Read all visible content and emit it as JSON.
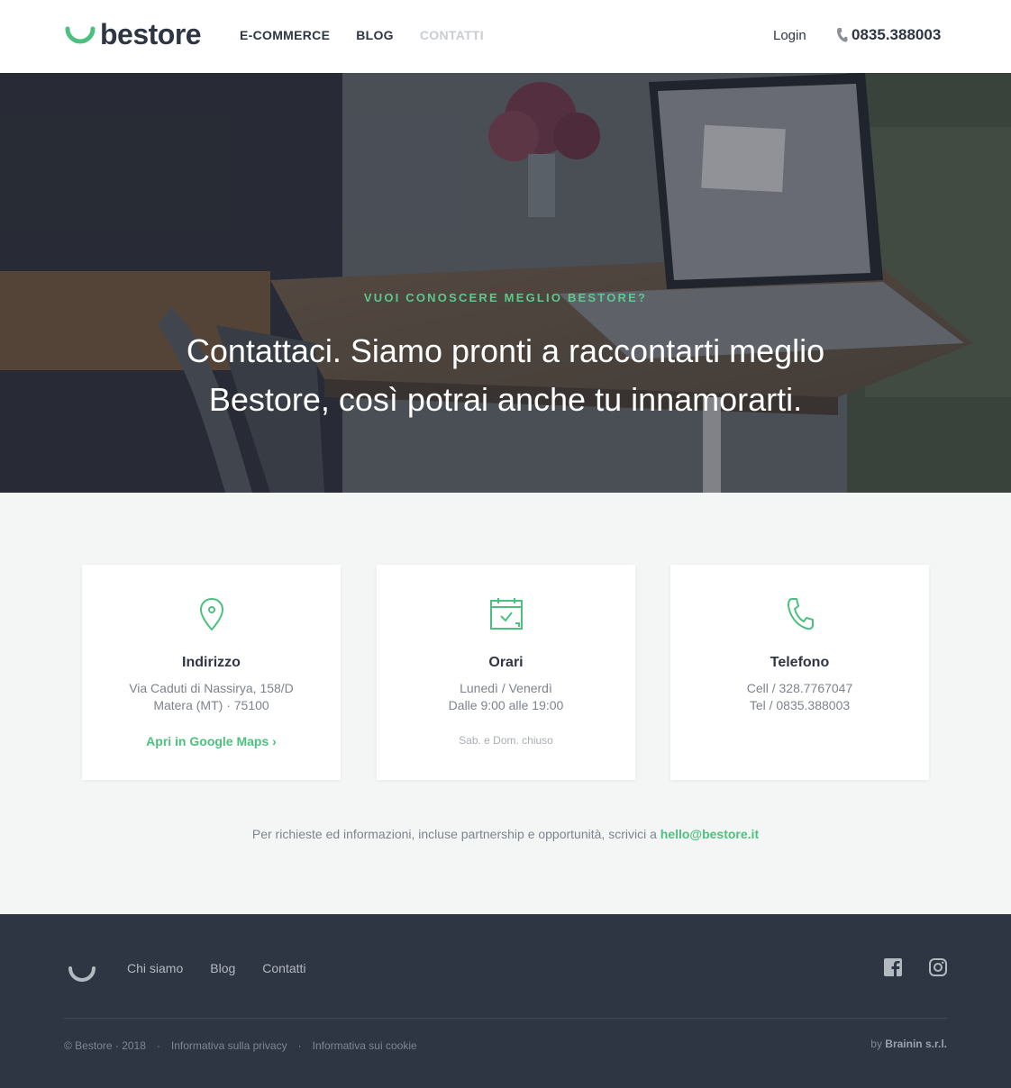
{
  "header": {
    "logo_text": "bestore",
    "nav": [
      {
        "label": "E-COMMERCE",
        "active": false
      },
      {
        "label": "BLOG",
        "active": false
      },
      {
        "label": "CONTATTI",
        "active": true
      }
    ],
    "login_label": "Login",
    "phone": "0835.388003"
  },
  "hero": {
    "eyebrow": "VUOI CONOSCERE MEGLIO BESTORE?",
    "title": "Contattaci. Siamo pronti a raccontarti meglio Bestore, così potrai anche tu innamorarti."
  },
  "cards": {
    "address": {
      "icon": "map-pin-icon",
      "title": "Indirizzo",
      "line1": "Via Caduti di Nassirya, 158/D",
      "line2": "Matera (MT) · 75100",
      "link": "Apri in Google Maps ›"
    },
    "hours": {
      "icon": "calendar-check-icon",
      "title": "Orari",
      "line1": "Lunedì / Venerdì",
      "line2": "Dalle 9:00 alle 19:00",
      "note": "Sab. e Dom. chiuso"
    },
    "phone": {
      "icon": "phone-icon",
      "title": "Telefono",
      "line1": "Cell / 328.7767047",
      "line2": "Tel / 0835.388003"
    }
  },
  "contact": {
    "text": "Per richieste ed informazioni, incluse partnership e opportunità, scrivici a",
    "email": "hello@bestore.it"
  },
  "footer": {
    "nav": [
      "Chi siamo",
      "Blog",
      "Contatti"
    ],
    "social": [
      "facebook-icon",
      "instagram-icon"
    ],
    "copyright": "© Bestore · 2018",
    "privacy": "Informativa sulla privacy",
    "cookie": "Informativa sui cookie",
    "by_prefix": "by",
    "by_company": "Brainin s.r.l."
  },
  "colors": {
    "accent": "#4cc17f",
    "dark": "#2e3543",
    "footer_bg": "#2e3643",
    "section_bg": "#f4f6f6"
  }
}
